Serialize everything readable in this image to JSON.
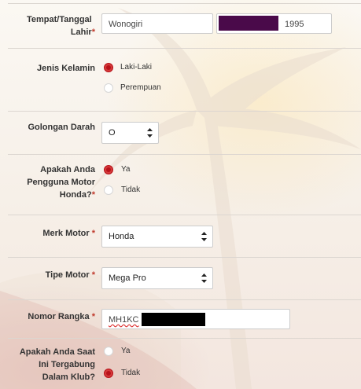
{
  "form": {
    "birth": {
      "label": "Tempat/Tanggal Lahir",
      "required_mark": "*",
      "place_value": "Wonogiri",
      "year_value": "1995"
    },
    "gender": {
      "label": "Jenis Kelamin",
      "options": [
        "Laki-Laki",
        "Perempuan"
      ],
      "selected": "Laki-Laki"
    },
    "blood_type": {
      "label": "Golongan Darah",
      "value": "O"
    },
    "honda_user": {
      "label_line1": "Apakah Anda",
      "label_line2": "Pengguna Motor",
      "label_line3": "Honda?",
      "required_mark": "*",
      "options": [
        "Ya",
        "Tidak"
      ],
      "selected": "Ya"
    },
    "motor_brand": {
      "label": "Merk Motor",
      "required_mark": "*",
      "value": "Honda"
    },
    "motor_type": {
      "label": "Tipe Motor",
      "required_mark": "*",
      "value": "Mega Pro"
    },
    "frame_number": {
      "label": "Nomor Rangka",
      "required_mark": "*",
      "value_prefix": "MH1KC"
    },
    "club": {
      "label_line1": "Apakah Anda Saat",
      "label_line2": "Ini Tergabung",
      "label_line3": "Dalam Klub?",
      "options": [
        "Ya",
        "Tidak"
      ],
      "selected": "Tidak"
    }
  },
  "colors": {
    "accent": "#b8121a",
    "required": "#c0392b",
    "border": "#cccccc"
  }
}
